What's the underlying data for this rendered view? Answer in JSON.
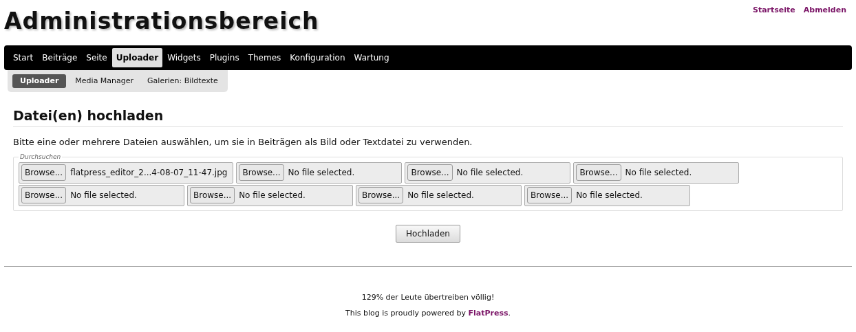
{
  "header": {
    "title": "Administrationsbereich",
    "links": [
      "Startseite",
      "Abmelden"
    ]
  },
  "nav": [
    {
      "label": "Start",
      "selected": false
    },
    {
      "label": "Beiträge",
      "selected": false
    },
    {
      "label": "Seite",
      "selected": false
    },
    {
      "label": "Uploader",
      "selected": true
    },
    {
      "label": "Widgets",
      "selected": false
    },
    {
      "label": "Plugins",
      "selected": false
    },
    {
      "label": "Themes",
      "selected": false
    },
    {
      "label": "Konfiguration",
      "selected": false
    },
    {
      "label": "Wartung",
      "selected": false
    }
  ],
  "subnav": [
    {
      "label": "Uploader",
      "selected": true
    },
    {
      "label": "Media Manager",
      "selected": false
    },
    {
      "label": "Galerien: Bildtexte",
      "selected": false
    }
  ],
  "section": {
    "heading": "Datei(en) hochladen",
    "intro": "Bitte eine oder mehrere Dateien auswählen, um sie in Beiträgen als Bild oder Textdatei zu verwenden.",
    "legend": "Durchsuchen",
    "files": [
      {
        "button": "Browse...",
        "value": "flatpress_editor_2...4-08-07_11-47.jpg"
      },
      {
        "button": "Browse...",
        "value": "No file selected."
      },
      {
        "button": "Browse...",
        "value": "No file selected."
      },
      {
        "button": "Browse...",
        "value": "No file selected."
      },
      {
        "button": "Browse...",
        "value": "No file selected."
      },
      {
        "button": "Browse...",
        "value": "No file selected."
      },
      {
        "button": "Browse...",
        "value": "No file selected."
      },
      {
        "button": "Browse...",
        "value": "No file selected."
      }
    ],
    "submit": "Hochladen"
  },
  "footer": {
    "tagline": "129% der Leute übertreiben völlig!",
    "powered_before": "This blog is proudly powered by ",
    "powered_link": "FlatPress",
    "powered_after": "."
  }
}
